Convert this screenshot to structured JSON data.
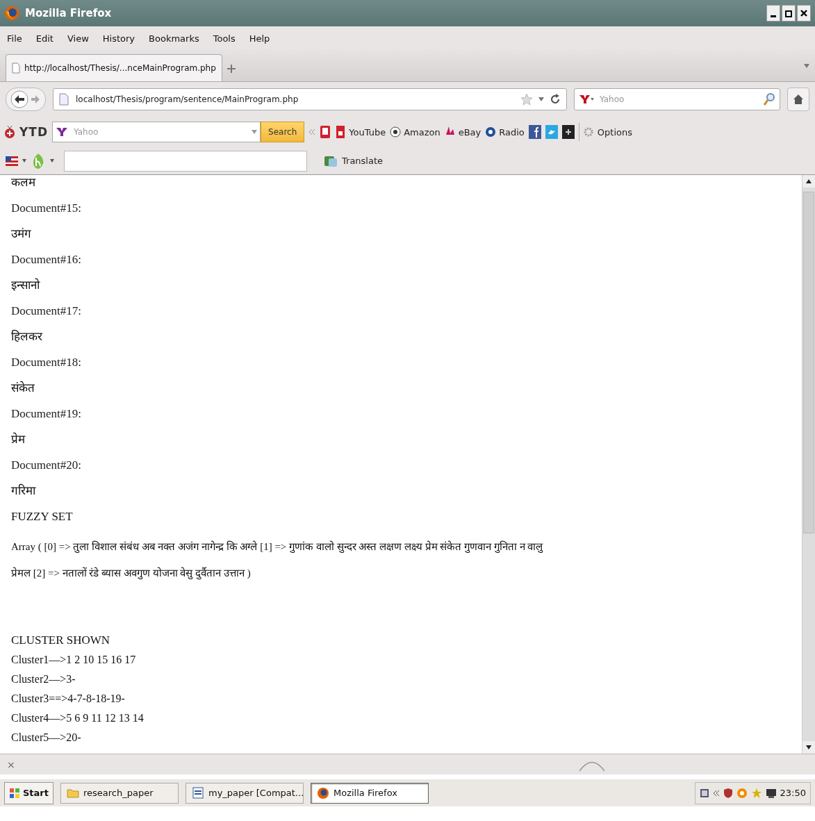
{
  "window": {
    "title": "Mozilla Firefox"
  },
  "menu": [
    "File",
    "Edit",
    "View",
    "History",
    "Bookmarks",
    "Tools",
    "Help"
  ],
  "tabs": [
    {
      "label": "http://localhost/Thesis/...nceMainProgram.php",
      "selected": true
    }
  ],
  "address_bar": {
    "value": "localhost/Thesis/program/sentence/MainProgram.php"
  },
  "search_bar": {
    "placeholder": "Yahoo"
  },
  "ytd_toolbar": {
    "logo": "YTD",
    "search_placeholder": "Yahoo",
    "search_button": "Search",
    "bookmarks": [
      "YouTube",
      "Amazon",
      "eBay",
      "Radio"
    ],
    "options": "Options"
  },
  "translate_bar": {
    "button": "Translate"
  },
  "content": {
    "entries": [
      {
        "kind": "word",
        "text": "कलम"
      },
      {
        "kind": "document",
        "text": "Document#15:"
      },
      {
        "kind": "word",
        "text": "उमंग"
      },
      {
        "kind": "document",
        "text": "Document#16:"
      },
      {
        "kind": "word",
        "text": "इन्सानो"
      },
      {
        "kind": "document",
        "text": "Document#17:"
      },
      {
        "kind": "word",
        "text": "हिलकर"
      },
      {
        "kind": "document",
        "text": "Document#18:"
      },
      {
        "kind": "word",
        "text": "संकेत"
      },
      {
        "kind": "document",
        "text": "Document#19:"
      },
      {
        "kind": "word",
        "text": "प्रेम"
      },
      {
        "kind": "document",
        "text": "Document#20:"
      },
      {
        "kind": "word",
        "text": "गरिमा"
      }
    ],
    "fuzzy_heading": "FUZZY SET",
    "fuzzy_lines": [
      "Array ( [0] => तुला विशाल संबंध अब नक्त अजंग नागेन्द्र कि अग्ले [1] => गुणांक वालो सुन्दर अस्त लक्षण लक्ष्य प्रेम संकेत गुणवान गुनिता न वालु",
      "प्रेमल [2] => नतालों रंडे ब्यास अवगुण योजना वेसु दुर्वैतान उत्तान )"
    ],
    "cluster_heading": "CLUSTER SHOWN",
    "clusters": [
      "Cluster1—>1 2 10 15 16 17",
      "Cluster2—>3-",
      "Cluster3==>4-7-8-18-19-",
      "Cluster4—>5 6 9 11 12 13 14",
      "Cluster5—>20-"
    ]
  },
  "status_bar": {
    "close": "×"
  },
  "taskbar": {
    "start": "Start",
    "items": [
      {
        "label": "research_paper",
        "kind": "folder",
        "selected": false
      },
      {
        "label": "my_paper [Compat...",
        "kind": "document",
        "selected": false
      },
      {
        "label": "Mozilla Firefox",
        "kind": "browser",
        "selected": true
      }
    ],
    "clock": "23:50"
  }
}
